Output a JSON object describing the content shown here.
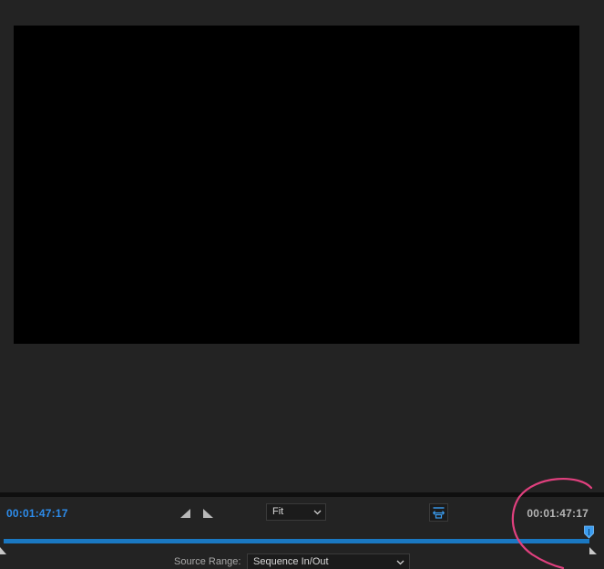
{
  "program_monitor": {
    "current_timecode": "00:01:47:17",
    "duration_timecode": "00:01:47:17",
    "zoom": {
      "selected": "Fit"
    },
    "source_range": {
      "label": "Source Range:",
      "selected": "Sequence In/Out"
    },
    "playhead_position": 1.0,
    "icons": {
      "mark_in": "mark-in-icon",
      "mark_out": "mark-out-icon",
      "fit_zoom": "fit-width-icon",
      "playhead": "playhead-icon"
    }
  },
  "colors": {
    "accent": "#2d8ceb",
    "track": "#1a78c2",
    "annotation": "#e0407e",
    "background": "#232323",
    "preview": "#000000"
  }
}
